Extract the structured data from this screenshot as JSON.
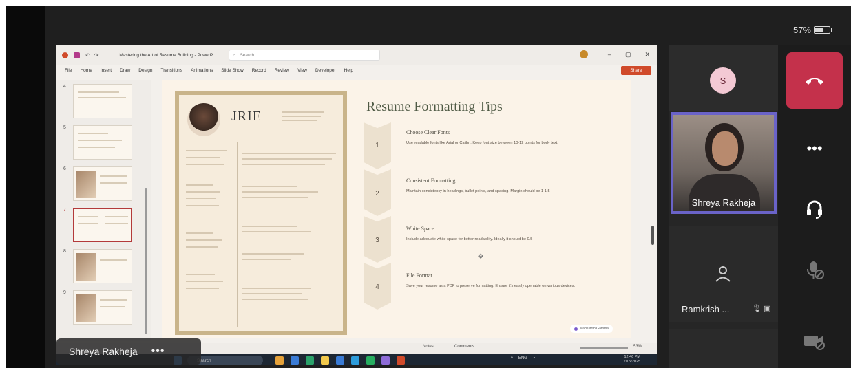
{
  "device": {
    "battery": "57%"
  },
  "ppt": {
    "title": "Mastering the Art of Resume Building - PowerP...",
    "search_placeholder": "Search",
    "menu": [
      "File",
      "Home",
      "Insert",
      "Draw",
      "Design",
      "Transitions",
      "Animations",
      "Slide Show",
      "Record",
      "Review",
      "View",
      "Developer",
      "Help"
    ],
    "share_label": "Share",
    "thumb_numbers": [
      "4",
      "5",
      "6",
      "7",
      "8",
      "9"
    ],
    "selected_slide": "7",
    "status": {
      "notes": "Notes",
      "comments": "Comments",
      "zoom": "53%"
    }
  },
  "slide": {
    "resume_name": "JRIE",
    "title": "Resume Formatting Tips",
    "tips": [
      {
        "num": "1",
        "title": "Choose Clear Fonts",
        "body": "Use readable fonts like Arial or Calibri. Keep font size between 10-12 points for body text."
      },
      {
        "num": "2",
        "title": "Consistent Formatting",
        "body": "Maintain consistency in headings, bullet points, and spacing. Margin should be 1-1.5"
      },
      {
        "num": "3",
        "title": "White Space",
        "body": "Include adequate white space for better readability. Ideally it should be 0.5"
      },
      {
        "num": "4",
        "title": "File Format",
        "body": "Save your resume as a PDF to preserve formatting. Ensure it's easily openable on various devices."
      }
    ],
    "badge": "Made with Gamma"
  },
  "taskbar": {
    "search": "Search",
    "lang": "ENG",
    "time": "12:46 PM",
    "date": "2/15/2025"
  },
  "presenter": {
    "name": "Shreya Rakheja"
  },
  "participants": {
    "s_initial": "S",
    "video_name": "Shreya Rakheja",
    "ramkrish_name": "Ramkrish ..."
  },
  "icons": {
    "hangup": "phone-hangup-icon",
    "more": "more-options-icon",
    "audio": "headset-icon",
    "mic": "mic-off-icon",
    "camera": "camera-off-icon"
  },
  "colors": {
    "hangup": "#c4314b",
    "video_border": "#6a63c8",
    "share": "#d04a2a",
    "slide_title": "#4f5a45"
  }
}
